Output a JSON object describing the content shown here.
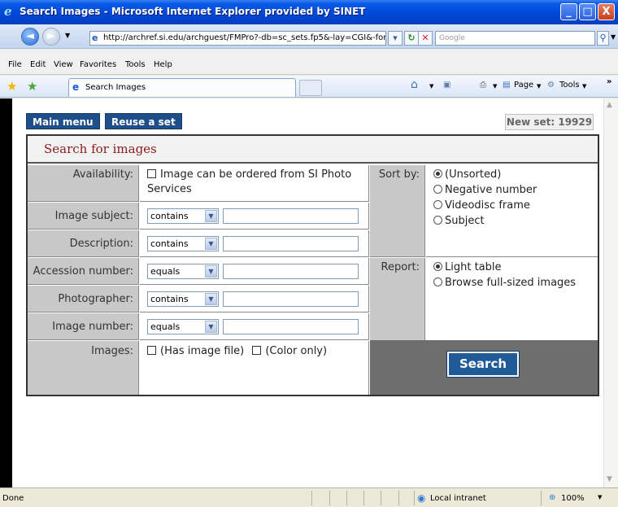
{
  "window": {
    "title": "Search Images - Microsoft Internet Explorer provided by SINET",
    "buttons": {
      "minimize": "_",
      "maximize": "□",
      "close": "X"
    }
  },
  "addressbar": {
    "url": "http://archref.si.edu/archguest/FMPro?-db=sc_sets.fp5&-lay=CGI&-for",
    "search_placeholder": "Google"
  },
  "menu": [
    "File",
    "Edit",
    "View",
    "Favorites",
    "Tools",
    "Help"
  ],
  "tab": {
    "label": "Search Images"
  },
  "commandbar": {
    "page": "Page",
    "tools": "Tools"
  },
  "toolbar": {
    "main_menu": "Main menu",
    "reuse_set": "Reuse a set",
    "new_set": "New set: 19929"
  },
  "form": {
    "heading": "Search for images",
    "availability": {
      "label": "Availability:",
      "option": "Image can be ordered from SI Photo Services"
    },
    "fields": [
      {
        "label": "Image subject:",
        "operator": "contains",
        "value": ""
      },
      {
        "label": "Description:",
        "operator": "contains",
        "value": ""
      },
      {
        "label": "Accession number:",
        "operator": "equals",
        "value": ""
      },
      {
        "label": "Photographer:",
        "operator": "contains",
        "value": ""
      },
      {
        "label": "Image number:",
        "operator": "equals",
        "value": ""
      }
    ],
    "images": {
      "label": "Images:",
      "has_image_file": "(Has image file)",
      "color_only": "(Color only)"
    },
    "sort": {
      "label": "Sort by:",
      "options": [
        "(Unsorted)",
        "Negative number",
        "Videodisc frame",
        "Subject"
      ],
      "selected": "(Unsorted)"
    },
    "report": {
      "label": "Report:",
      "options": [
        "Light table",
        "Browse full-sized images"
      ],
      "selected": "Light table"
    },
    "search_button": "Search"
  },
  "statusbar": {
    "status": "Done",
    "zone": "Local intranet",
    "zoom": "100%"
  }
}
